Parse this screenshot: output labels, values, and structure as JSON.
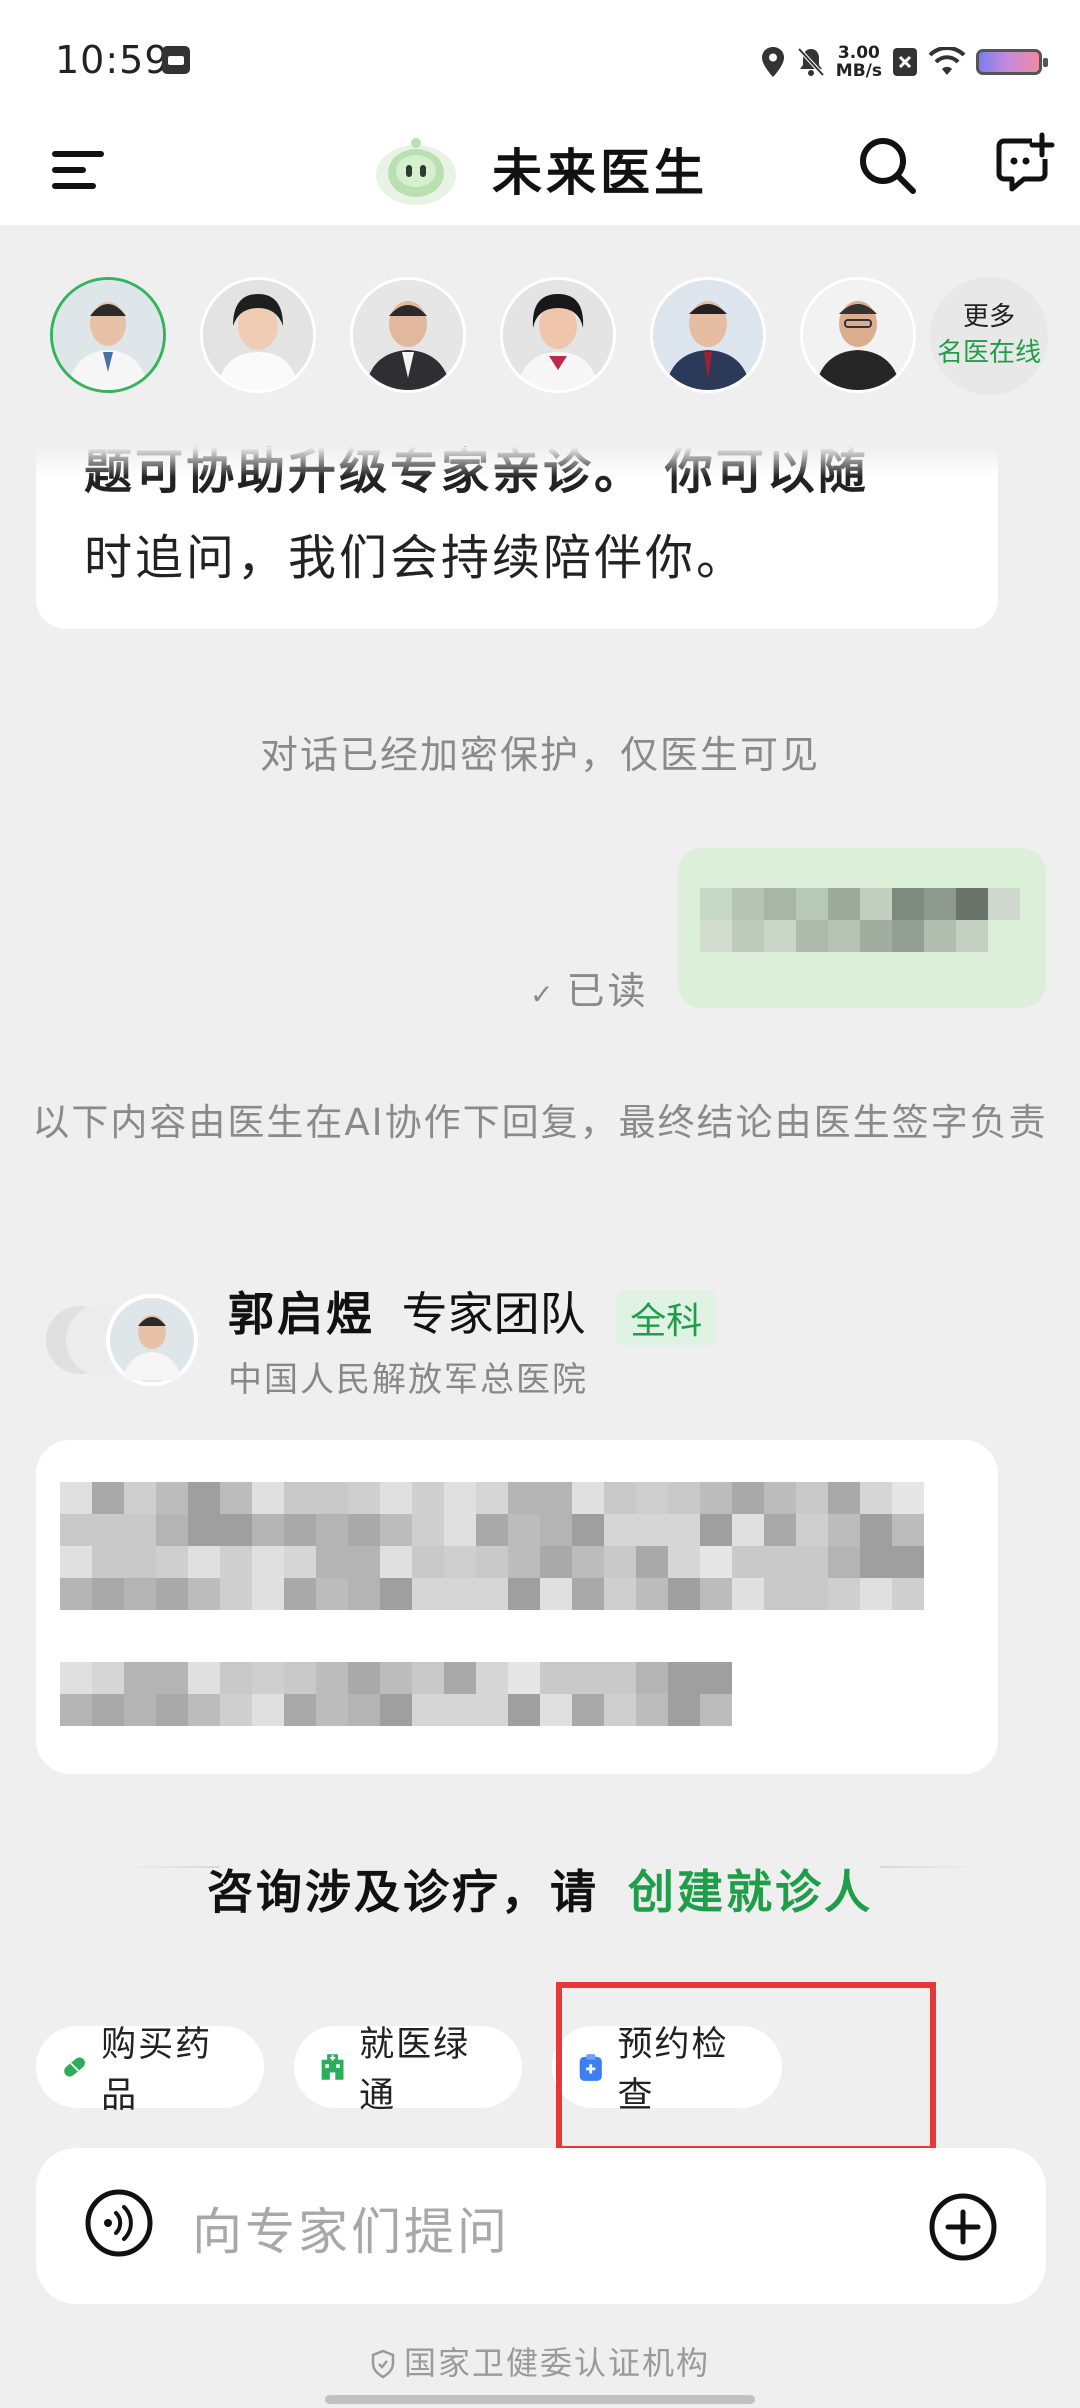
{
  "status_bar": {
    "time": "10:59",
    "net_speed_value": "3.00",
    "net_speed_unit": "MB/s"
  },
  "header": {
    "title": "未来医生"
  },
  "experts": {
    "more_line1": "更多",
    "more_line2": "名医在线"
  },
  "chat": {
    "prev_message_line1": "题可协助升级专家亲诊。 你可以随",
    "prev_message_line2": "时追问，我们会持续陪伴你。",
    "encryption_notice": "对话已经加密保护，仅医生可见",
    "read_status": "已读",
    "ai_note": "以下内容由医生在AI协作下回复，最终结论由医生签字负责",
    "team": {
      "name": "郭启煜",
      "suffix": "专家团队",
      "department": "全科",
      "hospital": "中国人民解放军总医院"
    },
    "create_prompt": "咨询涉及诊疗，请",
    "create_link": "创建就诊人"
  },
  "quick_actions": [
    {
      "label": "购买药品",
      "icon": "pill-icon"
    },
    {
      "label": "就医绿通",
      "icon": "hospital-icon"
    },
    {
      "label": "预约检查",
      "icon": "clipboard-icon"
    }
  ],
  "input": {
    "placeholder": "向专家们提问"
  },
  "footer": {
    "certification": "国家卫健委认证机构"
  },
  "colors": {
    "accent_green": "#1f9e49",
    "highlight_red": "#e53935",
    "user_bubble": "#dcefd9"
  }
}
